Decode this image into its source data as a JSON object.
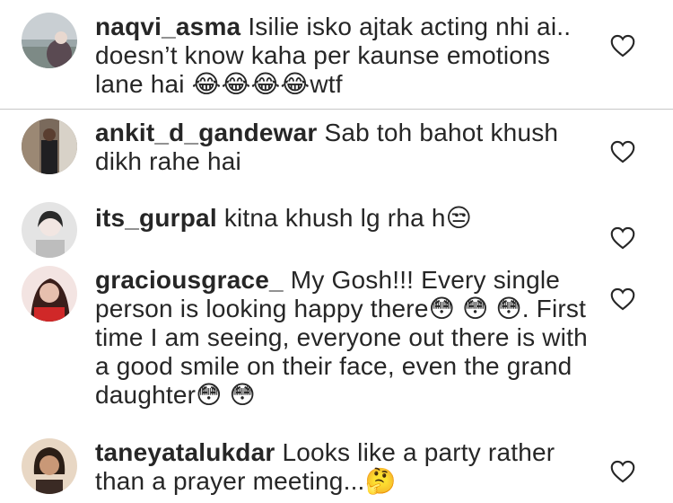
{
  "comments": [
    {
      "username": "naqvi_asma",
      "text": "Isilie isko ajtak acting nhi ai.. doesn’t know kaha per kaunse emotions lane hai 😂😂😂😂wtf",
      "heart_icon": "heart-outline-icon"
    },
    {
      "username": "ankit_d_gandewar",
      "text": "Sab toh bahot khush dikh rahe hai",
      "heart_icon": "heart-outline-icon"
    },
    {
      "username": "its_gurpal",
      "text": "kitna khush lg rha h😒",
      "heart_icon": "heart-outline-icon"
    },
    {
      "username": "graciousgrace_",
      "text": "My Gosh!!! Every single person is looking happy there😳 😳 😳. First time I am seeing, everyone out  there is with a good smile on their face, even the grand daughter😳 😳",
      "heart_icon": "heart-outline-icon"
    },
    {
      "username": "taneyatalukdar",
      "text": "Looks like a party rather than a prayer meeting...🤔",
      "heart_icon": "heart-outline-icon"
    }
  ],
  "colors": {
    "text": "#262626",
    "divider": "#c7c7c7",
    "heart": "#262626"
  }
}
